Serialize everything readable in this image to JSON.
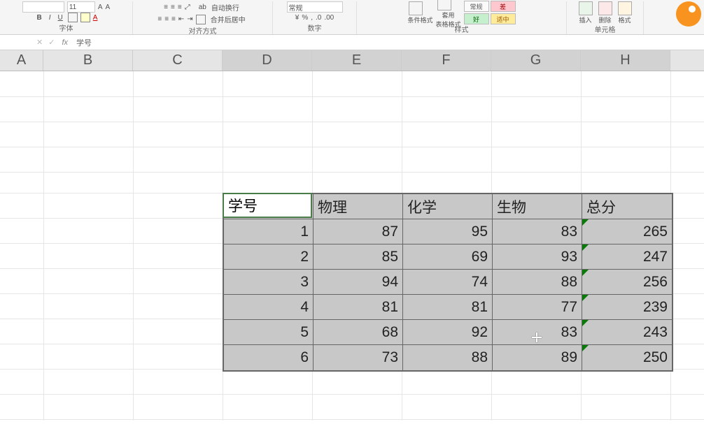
{
  "ribbon": {
    "font_size": "11",
    "bold": "B",
    "italic": "I",
    "underline": "U",
    "wrap_label": "自动换行",
    "merge_label": "合并后居中",
    "number_format": "常规",
    "font_group": "字体",
    "align_group": "对齐方式",
    "number_group": "数字",
    "cond_format": "条件格式",
    "table_format": "套用\n表格格式",
    "style_normal": "常规",
    "style_bad": "差",
    "style_good": "好",
    "style_neutral": "适中",
    "styles_group": "样式",
    "insert": "插入",
    "delete": "删除",
    "format": "格式",
    "cells_group": "单元格"
  },
  "formula_bar": {
    "name_box": "",
    "fx": "fx",
    "content": "学号"
  },
  "columns": [
    "A",
    "B",
    "C",
    "D",
    "E",
    "F",
    "G",
    "H"
  ],
  "selected_cols": [
    "D",
    "E",
    "F",
    "G",
    "H"
  ],
  "table": {
    "headers": [
      "学号",
      "物理",
      "化学",
      "生物",
      "总分"
    ],
    "rows": [
      {
        "id": "1",
        "physics": "87",
        "chem": "95",
        "bio": "83",
        "total": "265"
      },
      {
        "id": "2",
        "physics": "85",
        "chem": "69",
        "bio": "93",
        "total": "247"
      },
      {
        "id": "3",
        "physics": "94",
        "chem": "74",
        "bio": "88",
        "total": "256"
      },
      {
        "id": "4",
        "physics": "81",
        "chem": "81",
        "bio": "77",
        "total": "239"
      },
      {
        "id": "5",
        "physics": "68",
        "chem": "92",
        "bio": "83",
        "total": "243"
      },
      {
        "id": "6",
        "physics": "73",
        "chem": "88",
        "bio": "89",
        "total": "250"
      }
    ]
  }
}
